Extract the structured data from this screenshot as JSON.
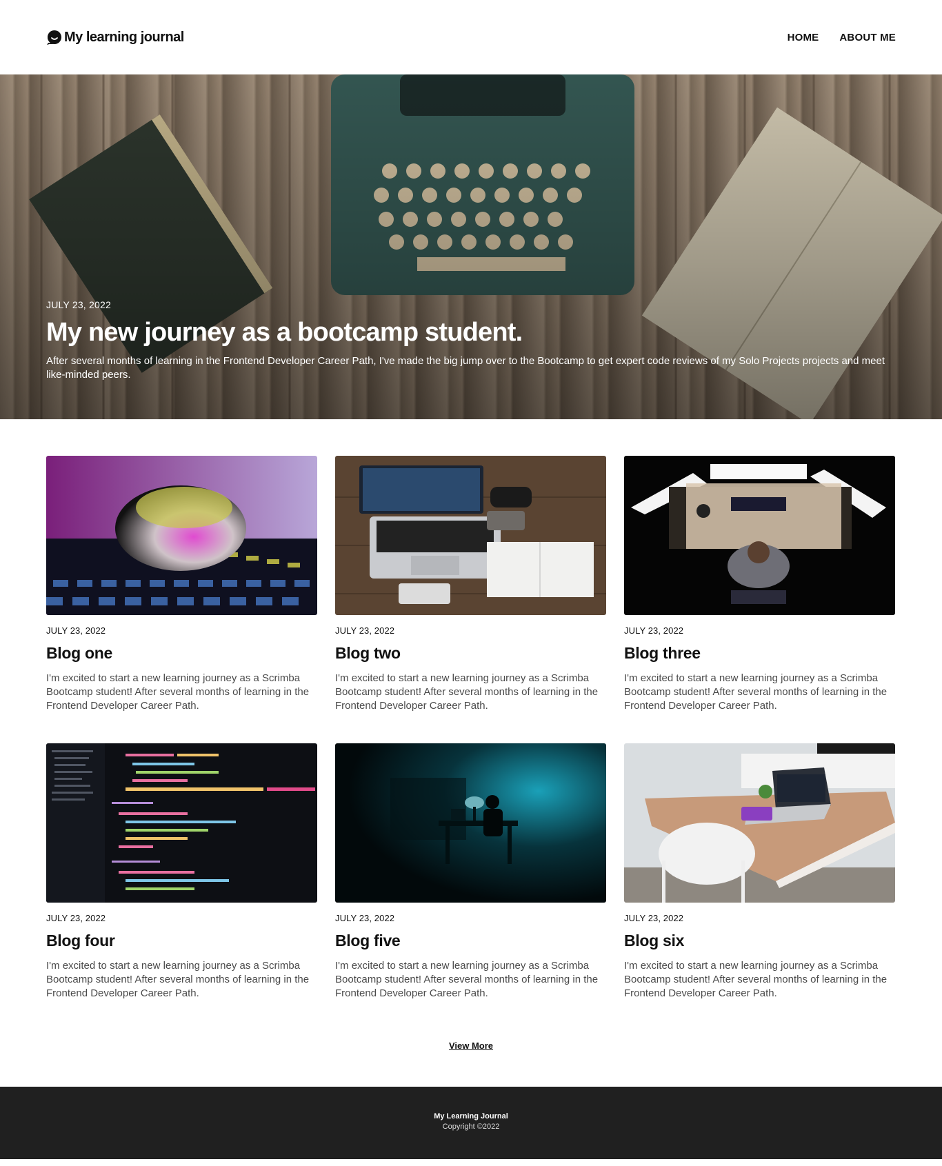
{
  "header": {
    "brand": "My learning journal",
    "logo_icon": "speech-bubble-smile-icon",
    "nav": [
      {
        "label": "HOME"
      },
      {
        "label": "ABOUT ME"
      }
    ]
  },
  "hero": {
    "date": "JULY 23, 2022",
    "title": "My new journey as a bootcamp student.",
    "description": "After several months of learning in the Frontend Developer Career Path, I've made the big jump over to the Bootcamp to get expert code reviews of my Solo Projects projects and meet like-minded peers.",
    "image": "typewriter-on-wooden-desk"
  },
  "posts": [
    {
      "date": "JULY 23, 2022",
      "title": "Blog one",
      "text": "I'm excited to start a new learning journey as a Scrimba Bootcamp student! After several months of learning in the Frontend Developer Career Path.",
      "image": "crystal-ball-neon-grid"
    },
    {
      "date": "JULY 23, 2022",
      "title": "Blog two",
      "text": "I'm excited to start a new learning journey as a Scrimba Bootcamp student! After several months of learning in the Frontend Developer Career Path.",
      "image": "laptop-on-wooden-desk"
    },
    {
      "date": "JULY 23, 2022",
      "title": "Blog three",
      "text": "I'm excited to start a new learning journey as a Scrimba Bootcamp student! After several months of learning in the Frontend Developer Career Path.",
      "image": "person-at-three-monitors"
    },
    {
      "date": "JULY 23, 2022",
      "title": "Blog four",
      "text": "I'm excited to start a new learning journey as a Scrimba Bootcamp student! After several months of learning in the Frontend Developer Career Path.",
      "image": "code-editor-dark"
    },
    {
      "date": "JULY 23, 2022",
      "title": "Blog five",
      "text": "I'm excited to start a new learning journey as a Scrimba Bootcamp student! After several months of learning in the Frontend Developer Career Path.",
      "image": "hooded-person-dark-room"
    },
    {
      "date": "JULY 23, 2022",
      "title": "Blog six",
      "text": "I'm excited to start a new learning journey as a Scrimba Bootcamp student! After several months of learning in the Frontend Developer Career Path.",
      "image": "white-desk-with-laptop"
    }
  ],
  "view_more": "View More",
  "footer": {
    "title": "My Learning Journal",
    "copyright": "Copyright ©2022"
  },
  "colors": {
    "text": "#111111",
    "body_text": "#4a4a4a",
    "footer_bg": "#202020"
  }
}
